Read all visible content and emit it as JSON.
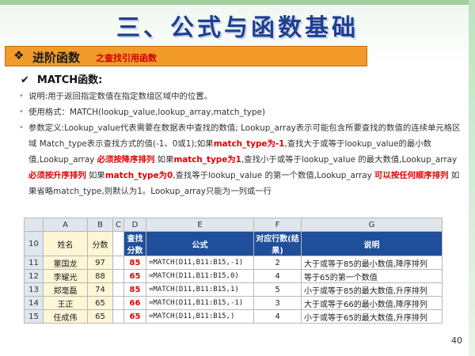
{
  "title": "三、公式与函数基础",
  "section": {
    "main": "进阶函数",
    "sub": "之查找引用函数"
  },
  "subheading": "MATCH函数:",
  "bullets": [
    [
      {
        "t": "说明:用于返回指定数值在指定数组区域中的位置。",
        "red": false
      }
    ],
    [
      {
        "t": "使用格式：MATCH(lookup_value,lookup_array,match_type)",
        "red": false
      }
    ],
    [
      {
        "t": "参数定义:Lookup_value代表需要在数据表中查找的数值; Lookup_array表示可能包含所要查找的数值的连续单元格区域 Match_type表示查找方式的值(-1、0或1);如果",
        "red": false
      },
      {
        "t": "match_type为-1",
        "red": true
      },
      {
        "t": ",查找大于或等于lookup_value的最小数值,Lookup_array ",
        "red": false
      },
      {
        "t": "必须按降序排列",
        "red": true
      },
      {
        "t": " 如果",
        "red": false
      },
      {
        "t": "match_type为1",
        "red": true
      },
      {
        "t": ",查找小于或等于lookup_value 的最大数值,Lookup_array ",
        "red": false
      },
      {
        "t": "必须按升序排列",
        "red": true
      },
      {
        "t": " 如果",
        "red": false
      },
      {
        "t": "match_type为0",
        "red": true
      },
      {
        "t": ",查找等于lookup_value 的第一个数值,Lookup_array ",
        "red": false
      },
      {
        "t": "可以按任何顺序排列",
        "red": true
      },
      {
        "t": " 如果省略match_type,则默认为1。Lookup_array只能为一列或一行",
        "red": false
      }
    ]
  ],
  "sheet": {
    "col_letters": [
      "A",
      "B",
      "C",
      "D",
      "E",
      "F",
      "G"
    ],
    "header_row_num": "10",
    "headers": [
      "姓名",
      "分数",
      "",
      "查找分数",
      "公式",
      "对应行数(结果)",
      "说明"
    ],
    "rows": [
      {
        "num": "11",
        "name": "董国龙",
        "score": "97",
        "d": "85",
        "formula": "=MATCH(D11,B11:B15,-1)",
        "result": "2",
        "desc": "大于或等于85的最小数值,降序排列"
      },
      {
        "num": "12",
        "name": "李耀光",
        "score": "88",
        "d": "65",
        "formula": "=MATCH(D11,B11:B15,0)",
        "result": "4",
        "desc": "等于65的第一个数值"
      },
      {
        "num": "13",
        "name": "郑毫磊",
        "score": "74",
        "d": "85",
        "formula": "=MATCH(D11,B11:B15,1)",
        "result": "5",
        "desc": "小于或等于85的最大数值,升序排列"
      },
      {
        "num": "14",
        "name": "王正",
        "score": "65",
        "d": "66",
        "formula": "=MATCH(D11,B11:B15,-1)",
        "result": "3",
        "desc": "大于或等于66的最小数值,降序排列"
      },
      {
        "num": "15",
        "name": "任成伟",
        "score": "65",
        "d": "65",
        "formula": "=MATCH(D11,B11:B15,)",
        "result": "4",
        "desc": "小于或等于65的最大数值,升序排列"
      }
    ]
  },
  "page_number": "40"
}
